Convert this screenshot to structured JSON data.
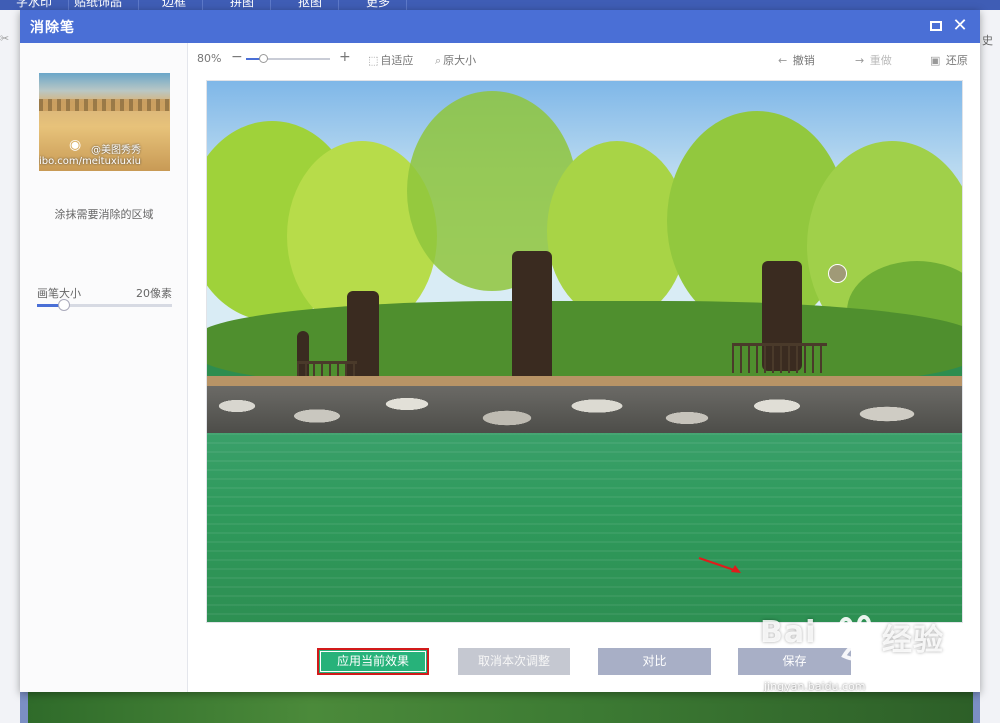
{
  "background_app": {
    "tabs": [
      "字水印",
      "贴纸饰品",
      "边框",
      "拼图",
      "抠图",
      "更多"
    ],
    "right_fragment": "史"
  },
  "dialog": {
    "title": "消除笔",
    "maximize_icon": "maximize-icon",
    "close_icon": "close-icon"
  },
  "left_panel": {
    "thumbnail_watermark": "@美图秀秀",
    "thumbnail_url": "ibo.com/meituxiuxiu",
    "hint": "涂抹需要消除的区域",
    "brush_size_label": "画笔大小",
    "brush_size_value": "20像素",
    "brush_slider_fraction": 0.2
  },
  "toolbar": {
    "zoom_level": "80%",
    "zoom_minus": "−",
    "zoom_plus": "+",
    "zoom_slider_fraction": 0.2,
    "fit_label": "自适应",
    "original_label": "原大小",
    "undo_label": "撤销",
    "redo_label": "重做",
    "restore_label": "还原"
  },
  "buttons": {
    "apply": "应用当前效果",
    "cancel": "取消本次调整",
    "compare": "对比",
    "save": "保存"
  },
  "watermark": {
    "brand": "Bai",
    "experience": "经验",
    "url": "jingyan.baidu.com"
  },
  "colors": {
    "title_bar": "#4a6fd6",
    "apply_button": "#27b27a",
    "apply_highlight": "#d21a1a",
    "secondary_button": "#a8afc6"
  }
}
